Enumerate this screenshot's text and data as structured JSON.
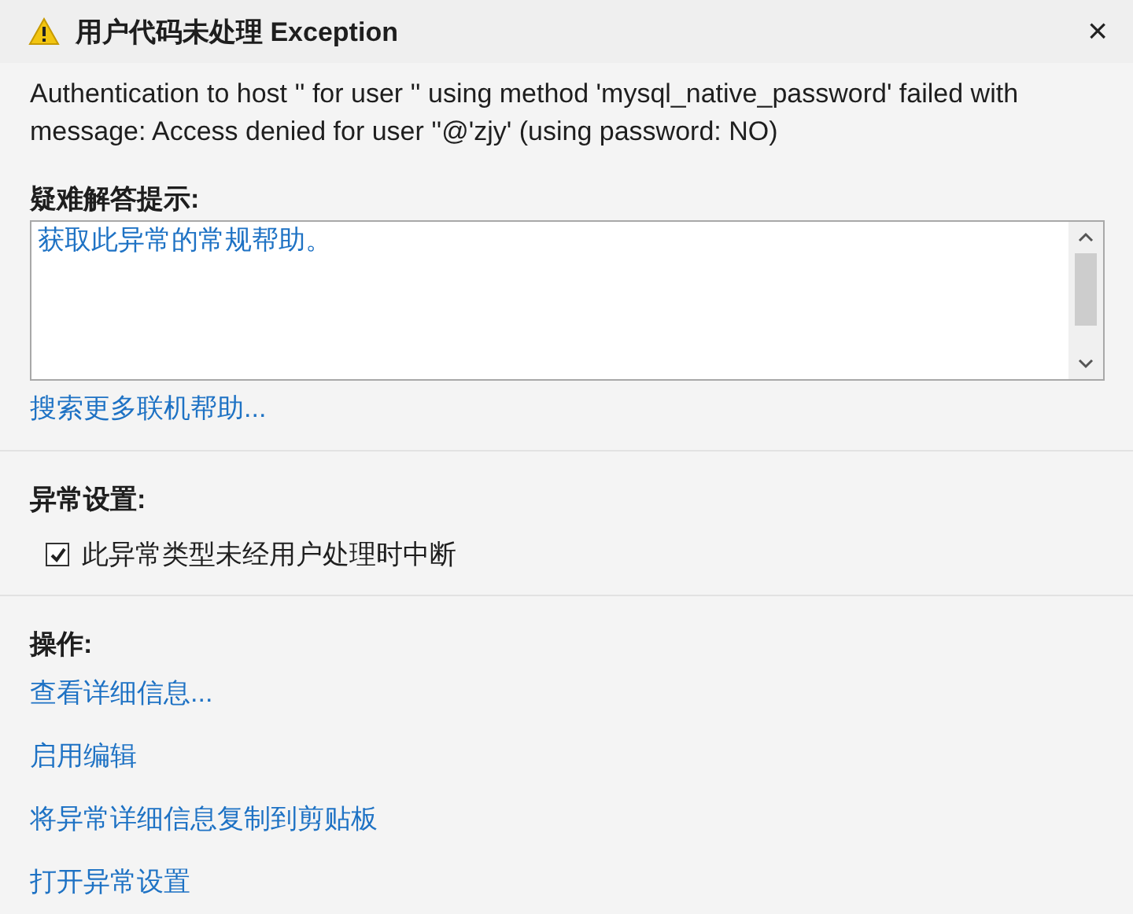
{
  "window": {
    "title": "用户代码未处理 Exception",
    "close": "×"
  },
  "message": "Authentication to host '' for user '' using method 'mysql_native_password' failed with message: Access denied for user ''@'zjy' (using password: NO)",
  "troubleshooting": {
    "heading": "疑难解答提示:",
    "items": [
      "获取此异常的常规帮助。"
    ],
    "link": "搜索更多联机帮助..."
  },
  "exception_settings": {
    "heading": "异常设置:",
    "checkbox": {
      "label": "此异常类型未经用户处理时中断",
      "checked": true
    }
  },
  "actions": {
    "heading": "操作:",
    "links": [
      "查看详细信息...",
      "启用编辑",
      "将异常详细信息复制到剪贴板",
      "打开异常设置"
    ]
  }
}
